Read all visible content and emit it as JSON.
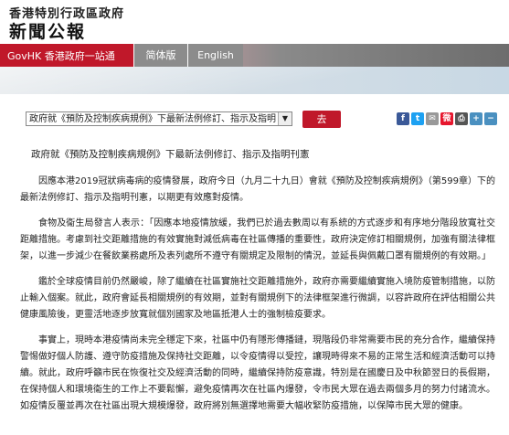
{
  "header": {
    "site_title": "香港特別行政區政府",
    "site_subtitle": "新聞公報"
  },
  "nav": {
    "govhk_label": "GovHK 香港政府一站通",
    "simplified_label": "简体版",
    "english_label": "English"
  },
  "toolbar": {
    "select_value": "政府就《預防及控制疾病規例》下最新法例修訂、指示及指明",
    "go_label": "去",
    "share_icons": [
      "facebook-icon",
      "twitter-icon",
      "email-icon",
      "sina-weibo-icon",
      "print-icon",
      "font-increase-icon",
      "font-decrease-icon"
    ]
  },
  "article": {
    "headline": "政府就《預防及控制疾病規例》下最新法例修訂、指示及指明刊憲",
    "paragraphs": [
      "因應本港2019冠狀病毒病的疫情發展，政府今日（九月二十九日）會就《預防及控制疾病規例》（第599章）下的最新法例修訂、指示及指明刊憲，以期更有效應對疫情。",
      "食物及衞生局發言人表示：「因應本地疫情放緩，我們已於過去數周以有系統的方式逐步和有序地分階段放寬社交距離措施。考慮到社交距離措施的有效實施對減低病毒在社區傳播的重要性，政府決定修訂相關規例，加強有關法律框架，以進一步減少在餐飲業務處所及表列處所不遵守有關規定及限制的情況，並延長與佩戴口罩有關規例的有效期。」",
      "鑑於全球疫情目前仍然嚴峻，除了繼續在社區實施社交距離措施外，政府亦需要繼續實施入境防疫管制措施，以防止輸入個案。就此，政府會延長相關規例的有效期，並對有關規例下的法律框架進行微調，以容許政府在評估相關公共健康風險後，更靈活地逐步放寬就個別國家及地區抵港人士的強制檢疫要求。",
      "事實上，現時本港疫情尚未完全穩定下來，社區中仍有隱形傳播鏈，現階段仍非常需要市民的充分合作，繼續保持警惕做好個人防護、遵守防疫措施及保持社交距離，以令疫情得以受控，讓現時得來不易的正常生活和經濟活動可以持續。就此，政府呼籲市民在恢復社交及經濟活動的同時，繼續保持防疫意識，特別是在國慶日及中秋節翌日的長假期，在保持個人和環境衞生的工作上不要鬆懈，避免疫情再次在社區內爆發，令市民大眾在過去兩個多月的努力付諸流水。如疫情反覆並再次在社區出現大規模爆發，政府將別無選擇地需要大幅收緊防疫措施，以保障市民大眾的健康。"
    ]
  },
  "colors": {
    "brand_red": "#c0182a",
    "nav_gray": "#8c8c8c"
  }
}
